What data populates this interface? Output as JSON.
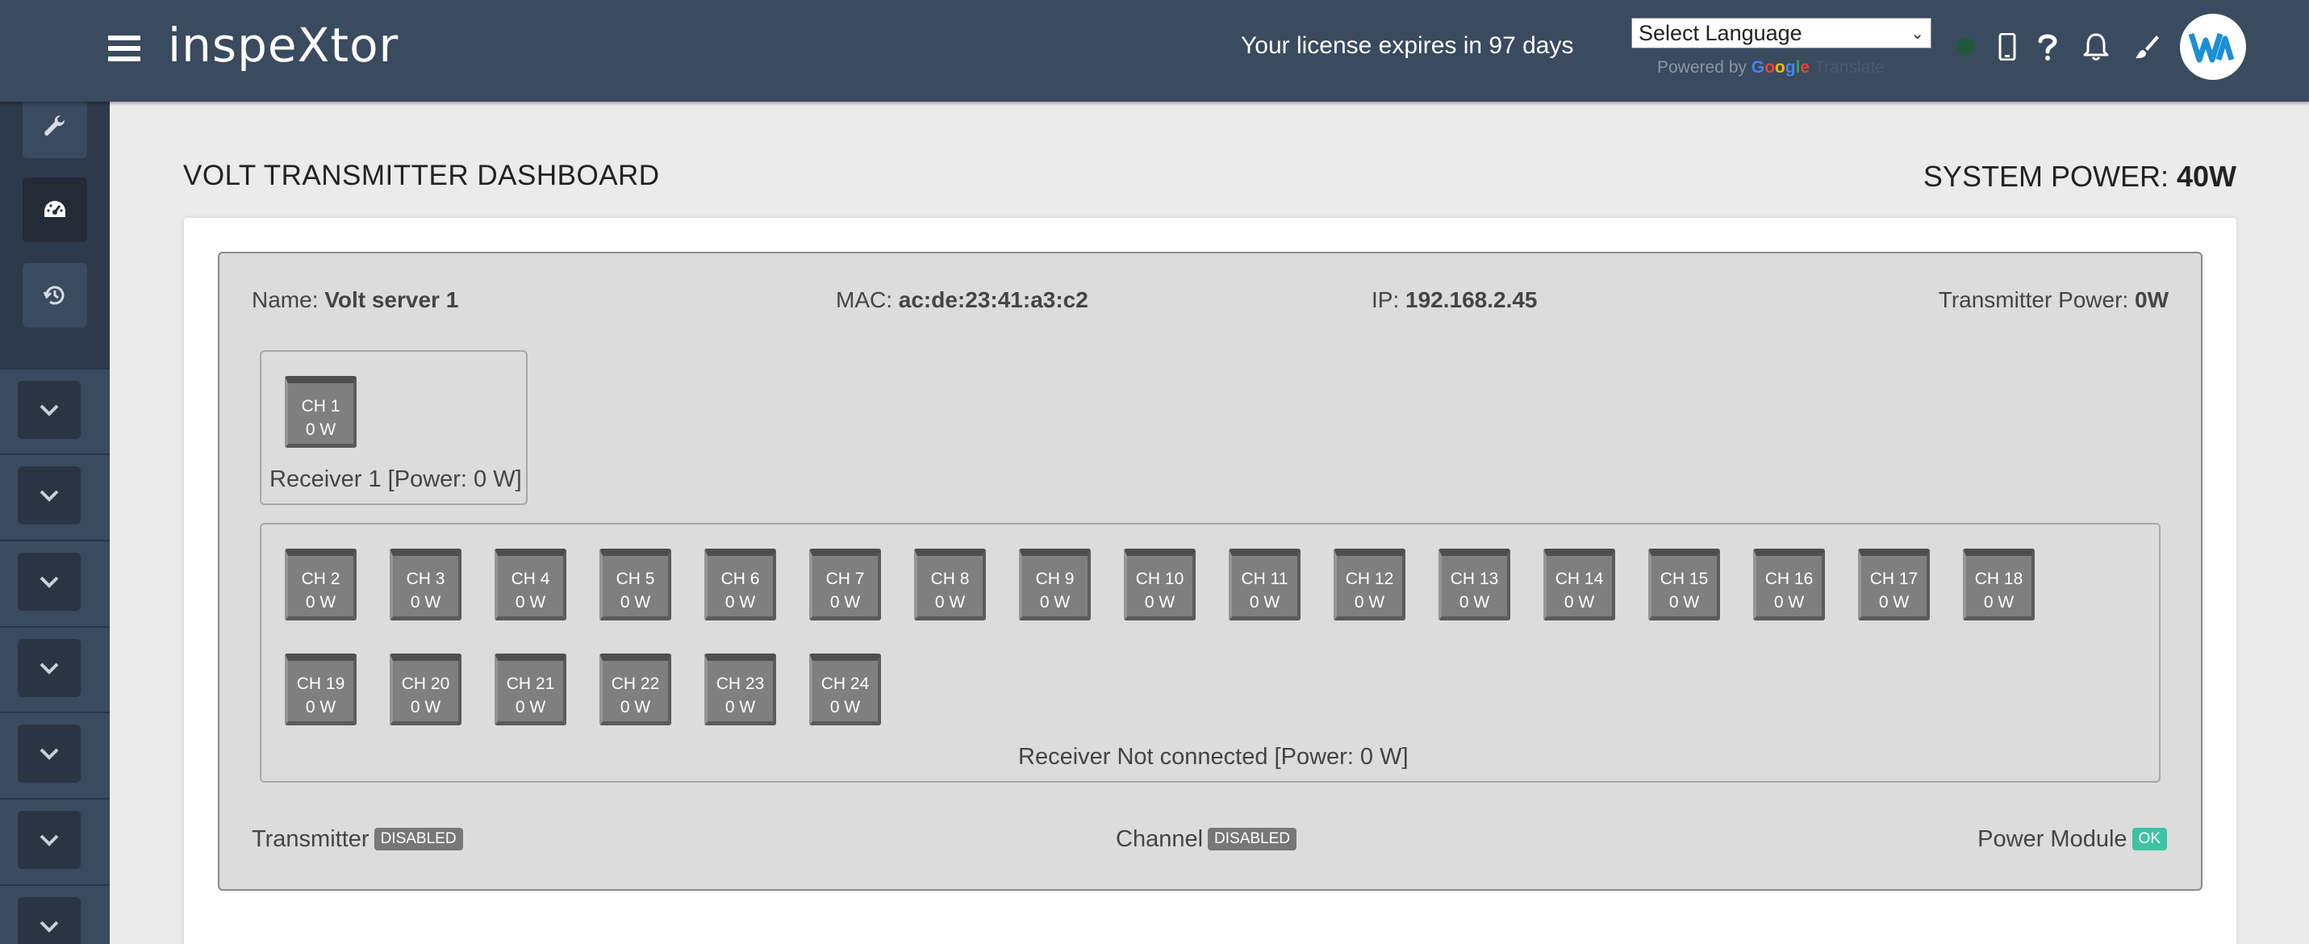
{
  "header": {
    "app_title": "inspeXtor",
    "license_text": "Your license expires in 97 days",
    "language_select": "Select Language",
    "powered_by": "Powered by",
    "google": "Google",
    "translate": "Translate",
    "status_color": "#1e5a3a"
  },
  "sidebar": {
    "buttons": [
      {
        "icon": "wrench-icon"
      },
      {
        "icon": "dashboard-icon",
        "active": true
      },
      {
        "icon": "history-icon"
      }
    ],
    "collapsed_items": 7
  },
  "page": {
    "title": "VOLT TRANSMITTER DASHBOARD",
    "system_power_label": "SYSTEM POWER:",
    "system_power_value": "40W"
  },
  "transmitter": {
    "name_label": "Name:",
    "name_value": "Volt server 1",
    "mac_label": "MAC:",
    "mac_value": "ac:de:23:41:a3:c2",
    "ip_label": "IP:",
    "ip_value": "192.168.2.45",
    "power_label": "Transmitter Power:",
    "power_value": "0W"
  },
  "receivers": [
    {
      "label": "Receiver 1 [Power: 0 W]",
      "channels": [
        {
          "name": "CH 1",
          "power": "0 W"
        }
      ]
    },
    {
      "label": "Receiver Not connected [Power: 0 W]",
      "channels": [
        {
          "name": "CH 2",
          "power": "0 W"
        },
        {
          "name": "CH 3",
          "power": "0 W"
        },
        {
          "name": "CH 4",
          "power": "0 W"
        },
        {
          "name": "CH 5",
          "power": "0 W"
        },
        {
          "name": "CH 6",
          "power": "0 W"
        },
        {
          "name": "CH 7",
          "power": "0 W"
        },
        {
          "name": "CH 8",
          "power": "0 W"
        },
        {
          "name": "CH 9",
          "power": "0 W"
        },
        {
          "name": "CH 10",
          "power": "0 W"
        },
        {
          "name": "CH 11",
          "power": "0 W"
        },
        {
          "name": "CH 12",
          "power": "0 W"
        },
        {
          "name": "CH 13",
          "power": "0 W"
        },
        {
          "name": "CH 14",
          "power": "0 W"
        },
        {
          "name": "CH 15",
          "power": "0 W"
        },
        {
          "name": "CH 16",
          "power": "0 W"
        },
        {
          "name": "CH 17",
          "power": "0 W"
        },
        {
          "name": "CH 18",
          "power": "0 W"
        },
        {
          "name": "CH 19",
          "power": "0 W"
        },
        {
          "name": "CH 20",
          "power": "0 W"
        },
        {
          "name": "CH 21",
          "power": "0 W"
        },
        {
          "name": "CH 22",
          "power": "0 W"
        },
        {
          "name": "CH 23",
          "power": "0 W"
        },
        {
          "name": "CH 24",
          "power": "0 W"
        }
      ]
    }
  ],
  "status": {
    "transmitter_label": "Transmitter",
    "transmitter_badge": "DISABLED",
    "channel_label": "Channel",
    "channel_badge": "DISABLED",
    "power_module_label": "Power Module",
    "power_module_badge": "OK",
    "disabled_color": "#777777",
    "ok_color": "#3cc4a4"
  }
}
